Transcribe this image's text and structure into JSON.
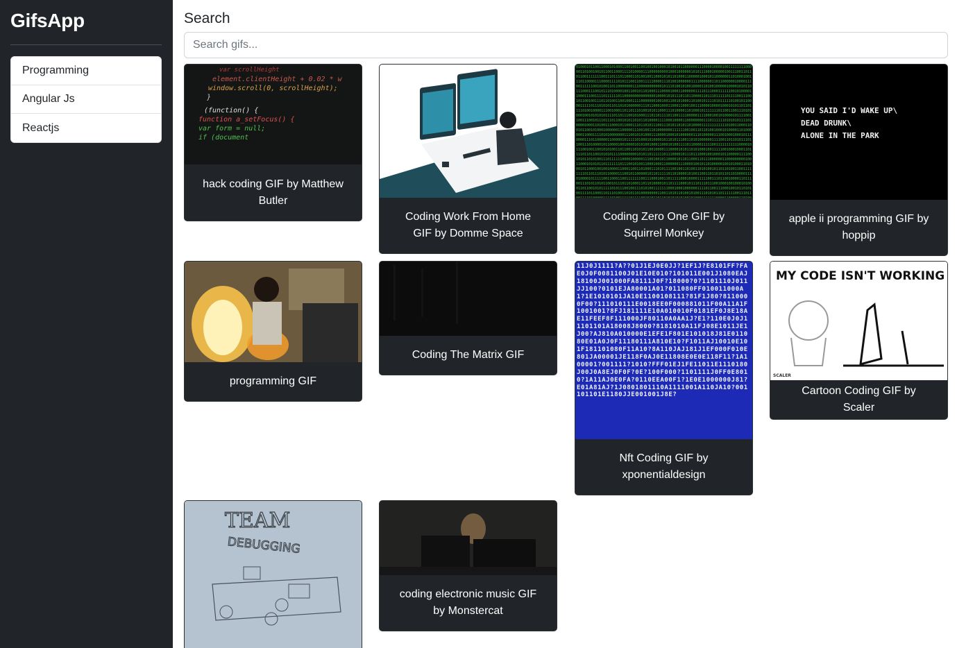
{
  "app": {
    "title": "GifsApp"
  },
  "sidebar": {
    "history": [
      {
        "label": "Programming"
      },
      {
        "label": "Angular Js"
      },
      {
        "label": "Reactjs"
      }
    ]
  },
  "main": {
    "title": "Search",
    "search": {
      "placeholder": "Search gifs...",
      "value": ""
    }
  },
  "gifs": [
    {
      "title": "hack coding GIF by Matthew Butler"
    },
    {
      "title": "Coding Work From Home GIF by Domme Space"
    },
    {
      "title": "Coding Zero One GIF by Squirrel Monkey"
    },
    {
      "title": "apple ii programming GIF by hoppip"
    },
    {
      "title": "programming GIF"
    },
    {
      "title": "Coding The Matrix GIF"
    },
    {
      "title": "Nft Coding GIF by xponentialdesign"
    },
    {
      "title": "Cartoon Coding GIF by Scaler"
    },
    {
      "title": "coding electronic music GIF by Monstercat"
    }
  ],
  "thumb_text": {
    "code_lines": [
      "var scrollHeight",
      "element.clientHeight + 0.02 * w",
      "window.scroll(0, scrollHeight);",
      "}",
      "(function() {",
      "function a_setFocus() {",
      "var form = null;",
      "if (document"
    ],
    "apple_lines": [
      "YOU SAID I'D WAKE UP\\",
      "DEAD DRUNK\\",
      "ALONE IN THE PARK"
    ],
    "cartoon_text": "MY CODE ISN'T WORKING ...",
    "cartoon_brand": "SCALER",
    "team_text_1": "TEAM",
    "team_text_2": "DEBUGGING"
  }
}
